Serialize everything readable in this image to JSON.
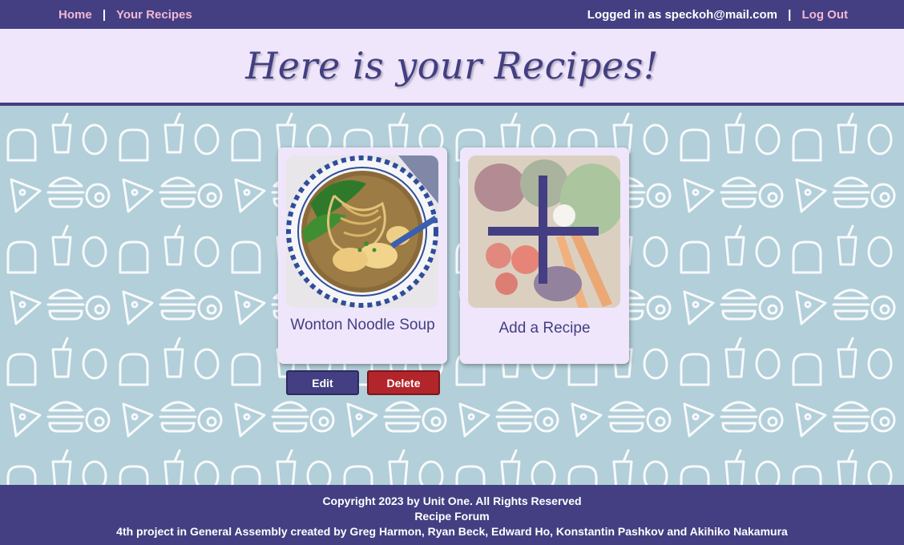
{
  "nav": {
    "home": "Home",
    "separator": "|",
    "your_recipes": "Your Recipes",
    "logged_in_text": "Logged in as speckoh@mail.com",
    "logout": "Log Out"
  },
  "banner": {
    "title": "Here is your Recipes!"
  },
  "recipes": [
    {
      "title": "Wonton Noodle Soup",
      "edit_label": "Edit",
      "delete_label": "Delete"
    }
  ],
  "add_card": {
    "title": "Add a Recipe"
  },
  "footer": {
    "line1": "Copyright 2023 by Unit One. All Rights Reserved",
    "line2": "Recipe Forum",
    "line3": "4th project in General Assembly created by Greg Harmon, Ryan Beck, Edward Ho, Konstantin Pashkov and Akihiko Nakamura"
  },
  "colors": {
    "primary": "#433f82",
    "accent_link": "#f3b8d4",
    "banner_bg": "#efe6fc",
    "pattern_bg": "#b3cfd9",
    "delete": "#b2252b"
  },
  "icons": {
    "pattern": "food-doodle-pattern",
    "add": "plus-icon"
  }
}
